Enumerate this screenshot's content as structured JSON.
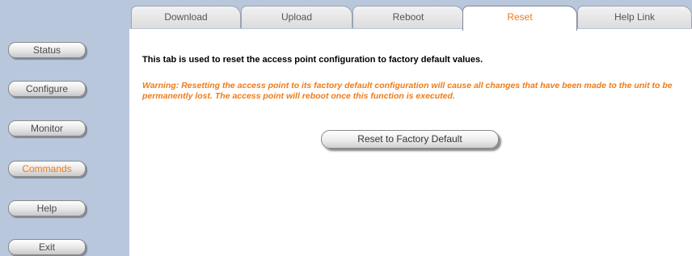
{
  "tabs": [
    {
      "label": "Download"
    },
    {
      "label": "Upload"
    },
    {
      "label": "Reboot"
    },
    {
      "label": "Reset",
      "active": true
    },
    {
      "label": "Help Link"
    }
  ],
  "sidebar": {
    "items": [
      {
        "label": "Status"
      },
      {
        "label": "Configure"
      },
      {
        "label": "Monitor"
      },
      {
        "label": "Commands",
        "active": true
      },
      {
        "label": "Help"
      },
      {
        "label": "Exit"
      }
    ]
  },
  "main": {
    "intro": "This tab is used to reset the access point configuration to factory default values.",
    "warning": "Warning: Resetting the access point to its factory default configuration will cause all changes that have been made to the unit to be permanently lost. The access point will reboot once this function is executed.",
    "reset_button_label": "Reset to Factory Default"
  },
  "colors": {
    "accent": "#f07a16",
    "sidebar_bg": "#b9c7dc"
  }
}
